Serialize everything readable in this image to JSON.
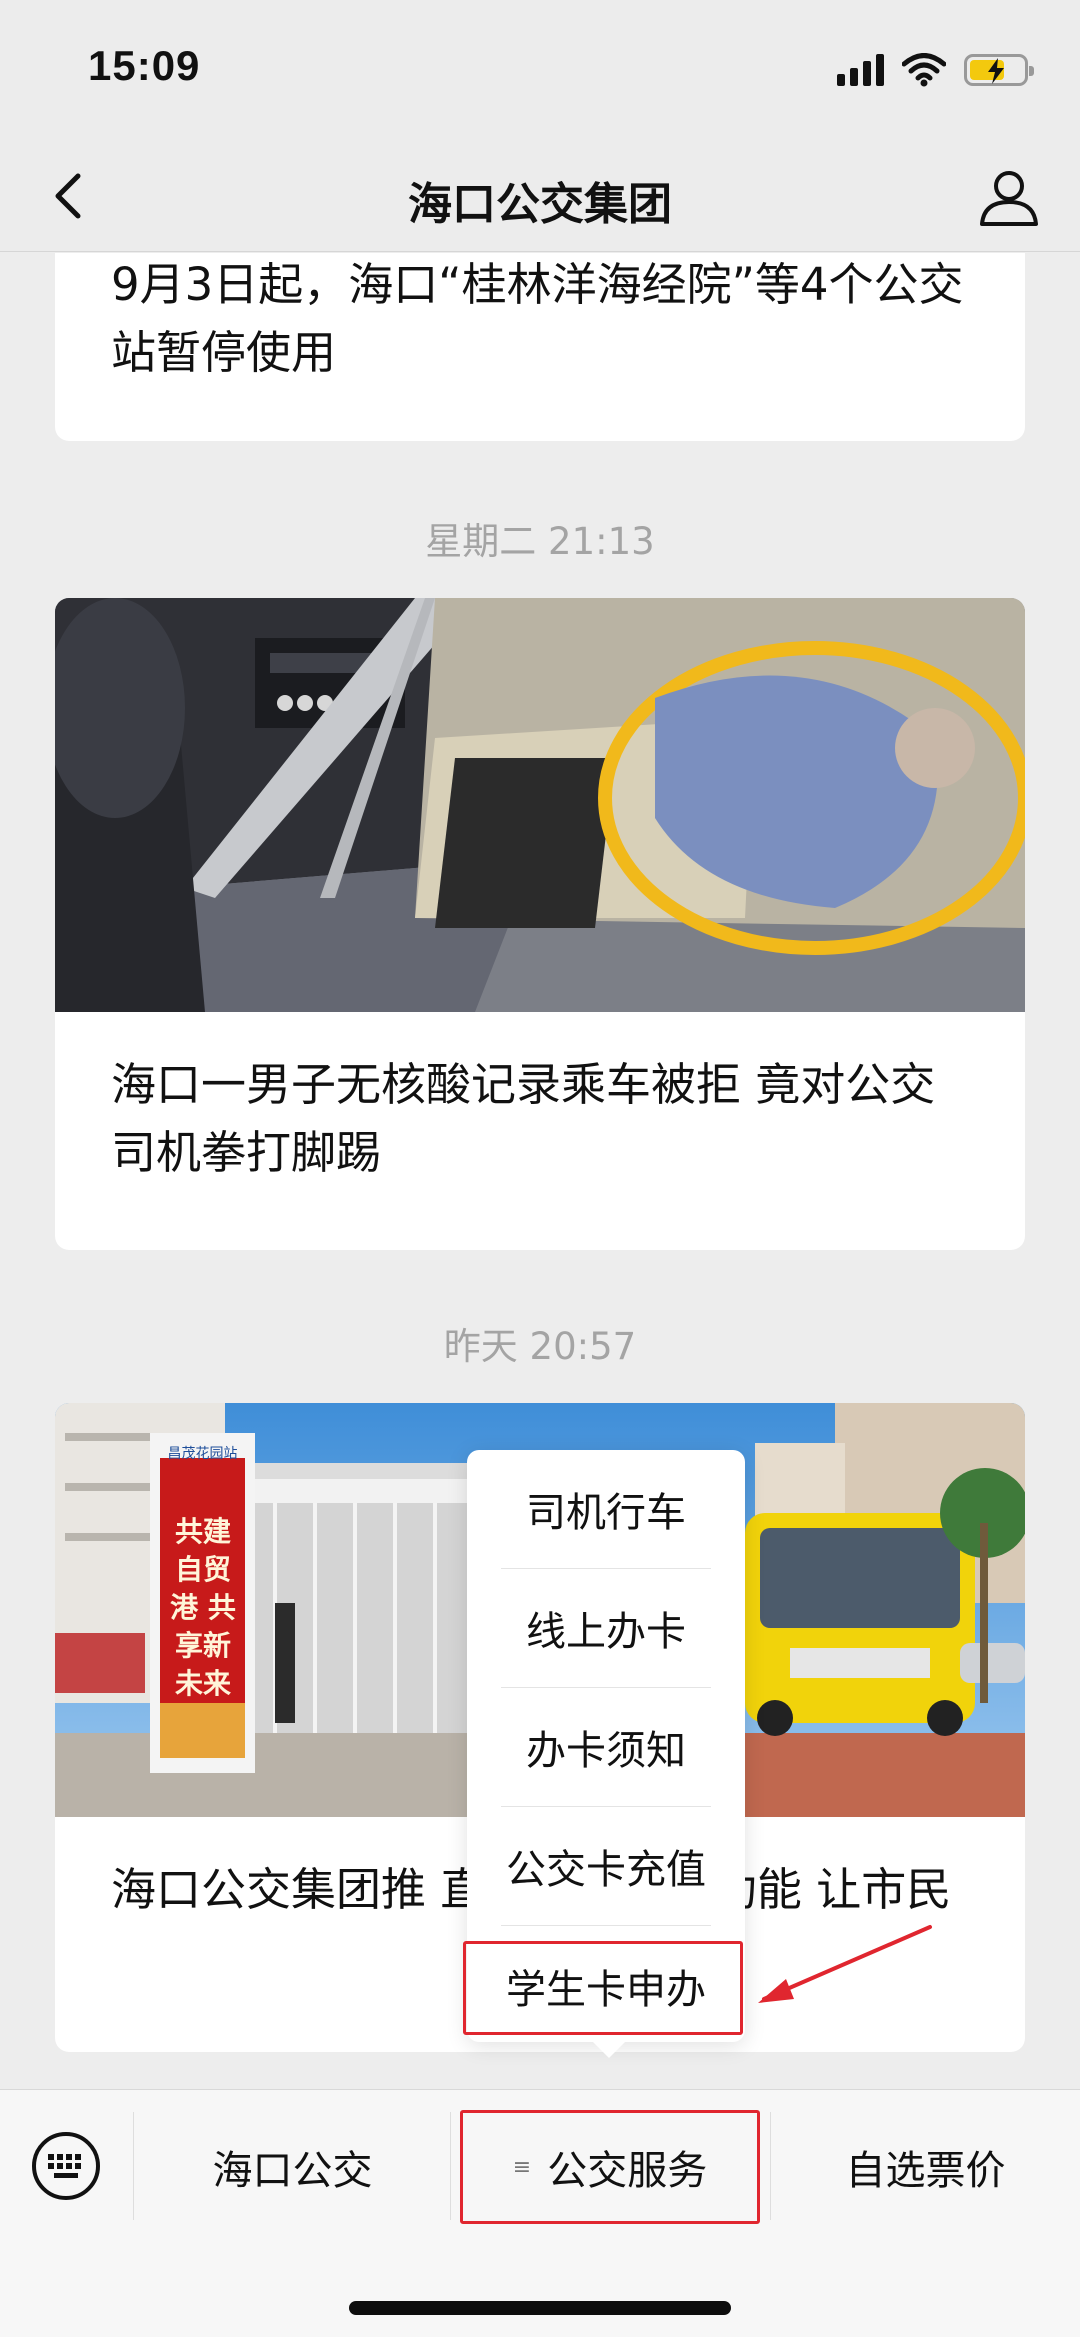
{
  "status_bar": {
    "time": "15:09"
  },
  "nav": {
    "title": "海口公交集团"
  },
  "feed": {
    "cards": [
      {
        "title": "9月3日起，海口“桂林洋海经院”等4个公交站暂停使用"
      },
      {
        "timestamp": "星期二 21:13",
        "title": "海口一男子无核酸记录乘车被拒 竟对公交司机拳打脚踢"
      },
      {
        "timestamp": "昨天 20:57",
        "title": "海口公交集团推 直跳“乘车码”功能 让市民",
        "image_text": {
          "stop_sign": "昌茂花园站",
          "poster": "共建自贸港 共享新未来"
        }
      }
    ]
  },
  "popup_menu": {
    "items": [
      "司机行车",
      "线上办卡",
      "办卡须知",
      "公交卡充值",
      "学生卡申办"
    ],
    "highlighted_item": "学生卡申办"
  },
  "bottom_menu": {
    "tabs": [
      "海口公交",
      "公交服务",
      "自选票价"
    ],
    "highlighted_tab": "公交服务",
    "menu_indicator": "≡"
  },
  "colors": {
    "accent_red": "#e0262f",
    "battery_yellow": "#f3c90e",
    "timestamp_gray": "#a4a4a4"
  },
  "icons": {
    "back": "chevron-left-icon",
    "profile": "person-icon",
    "keyboard": "keyboard-icon"
  }
}
